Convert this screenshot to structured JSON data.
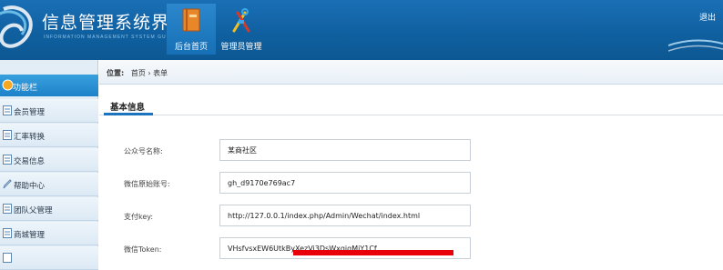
{
  "app": {
    "title": "信息管理系统界面",
    "subtitle": "INFORMATION MANAGEMENT SYSTEM GUI",
    "logout_label": "退出"
  },
  "nav": {
    "items": [
      {
        "label": "后台首页",
        "icon": "book-icon",
        "active": true
      },
      {
        "label": "管理员管理",
        "icon": "tools-icon",
        "active": false
      }
    ]
  },
  "sidebar": {
    "header_label": "功能栏",
    "items": [
      {
        "label": "会员管理",
        "icon": "document-icon"
      },
      {
        "label": "汇率转换",
        "icon": "document-icon"
      },
      {
        "label": "交易信息",
        "icon": "document-icon"
      },
      {
        "label": "帮助中心",
        "icon": "edit-icon"
      },
      {
        "label": "团队父管理",
        "icon": "document-icon"
      },
      {
        "label": "商城管理",
        "icon": "document-icon"
      }
    ]
  },
  "breadcrumb": {
    "prefix": "位置:",
    "items": [
      "首页",
      "表单"
    ],
    "separator": "›"
  },
  "form": {
    "section_title": "基本信息",
    "fields": [
      {
        "label": "公众号名称:",
        "value": "某商社区"
      },
      {
        "label": "微信原始账号:",
        "value": "gh_d9170e769ac7"
      },
      {
        "label": "支付key:",
        "value": "http://127.0.0.1/index.php/Admin/Wechat/index.html"
      },
      {
        "label": "微信Token:",
        "value": "VHsfvsxEW6UtkByXezVi3DsWxgjqMiY1Cf"
      }
    ]
  },
  "colors": {
    "header": "#1a6fb5",
    "sidebar": "#e2edf6",
    "accent": "#1b74bd",
    "highlight": "#e8000b"
  }
}
